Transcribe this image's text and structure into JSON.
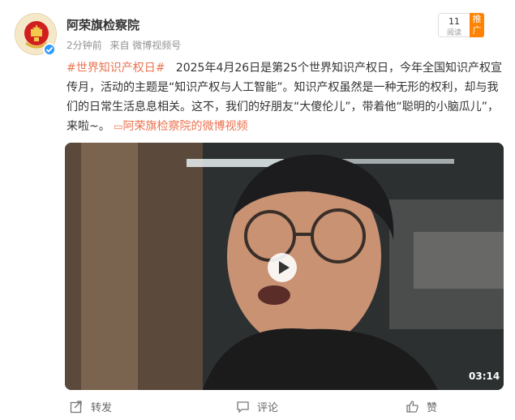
{
  "header": {
    "username": "阿荣旗检察院",
    "time": "2分钟前",
    "source": "来自 微博视频号"
  },
  "promo": {
    "count": "11",
    "sub": "阅读",
    "tag": "推广"
  },
  "post": {
    "hashtag": "#世界知识产权日#",
    "body": "2025年4月26日是第25个世界知识产权日，今年全国知识产权宣传月，活动的主题是“知识产权与人工智能”。知识产权虽然是一种无形的权利，却与我们的日常生活息息相关。这不，我们的好朋友“大傻伦儿”，带着他“聪明的小脑瓜儿”，来啦~。",
    "video_link": "阿荣旗检察院的微博视频",
    "video_link_icon": "video-camera-icon"
  },
  "video": {
    "duration": "03:14"
  },
  "actions": {
    "forward": "转发",
    "comment": "评论",
    "like": "赞"
  },
  "colors": {
    "link": "#eb7350",
    "verified": "#2f9bff",
    "promo_tag": "#ff8200"
  }
}
